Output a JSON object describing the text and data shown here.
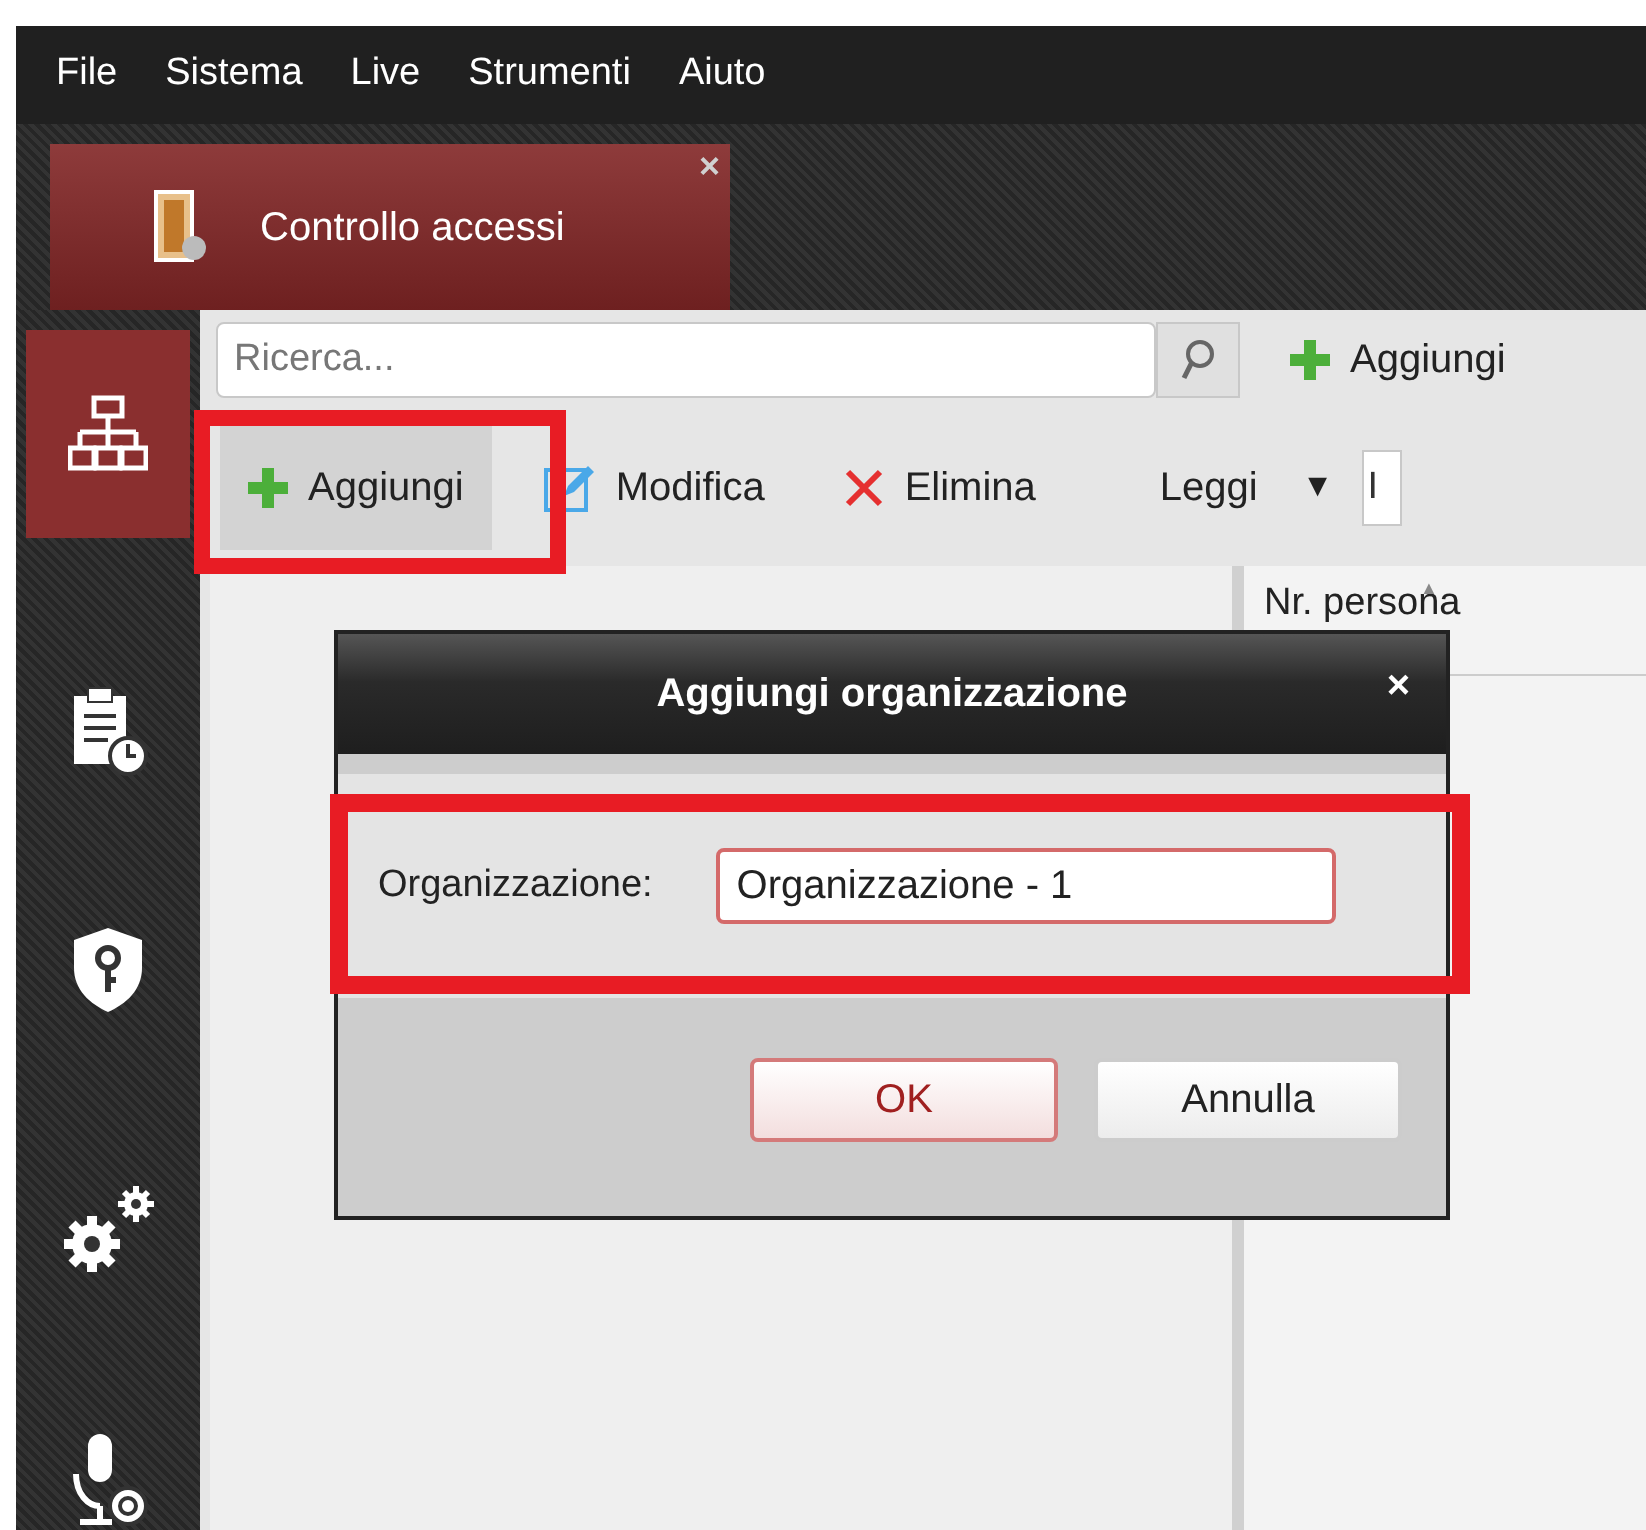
{
  "menu": [
    "File",
    "Sistema",
    "Live",
    "Strumenti",
    "Aiuto"
  ],
  "tabs": [
    {
      "label": "Controllo accessi",
      "close": "×",
      "selected": true
    }
  ],
  "sidebar": {
    "items": [
      {
        "kind": "organization",
        "selected": true
      },
      {
        "kind": "schedule",
        "selected": false
      },
      {
        "kind": "shield",
        "selected": false
      },
      {
        "kind": "settings",
        "selected": false
      },
      {
        "kind": "microphone",
        "selected": false
      }
    ]
  },
  "search": {
    "placeholder": "Ricerca..."
  },
  "right_toolbar": {
    "add": "Aggiungi"
  },
  "toolbar": [
    {
      "kind": "add",
      "label": "Aggiungi",
      "highlighted": true
    },
    {
      "kind": "edit",
      "label": "Modifica",
      "highlighted": false
    },
    {
      "kind": "delete",
      "label": "Elimina",
      "highlighted": false
    }
  ],
  "read_dropdown": {
    "label": "Leggi",
    "caret": "▼"
  },
  "partial_field": {
    "value": "I"
  },
  "table": {
    "columns": [
      {
        "label": "Nr. persona",
        "sort": "▲"
      }
    ]
  },
  "dialog": {
    "title": "Aggiungi organizzazione",
    "close": "×",
    "field_label": "Organizzazione:",
    "field_value": "Organizzazione - 1",
    "field_highlighted": true,
    "buttons": [
      {
        "kind": "primary",
        "label": "OK"
      },
      {
        "kind": "secondary",
        "label": "Annulla"
      }
    ]
  }
}
